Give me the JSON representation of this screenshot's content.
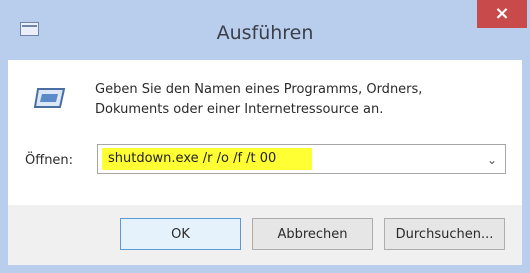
{
  "window": {
    "title": "Ausführen",
    "close_symbol": "×"
  },
  "dialog": {
    "description_line1": "Geben Sie den Namen eines Programms, Ordners,",
    "description_line2": "Dokuments oder einer Internetressource an.",
    "open_label": "Öffnen:",
    "open_value": "shutdown.exe /r /o /f /t 00",
    "dropdown_icon": "chevron-down"
  },
  "buttons": {
    "ok": "OK",
    "cancel": "Abbrechen",
    "browse": "Durchsuchen..."
  },
  "colors": {
    "titlebar": "#b9ceec",
    "close_button": "#c84a4a",
    "input_highlight": "#ffff33"
  }
}
